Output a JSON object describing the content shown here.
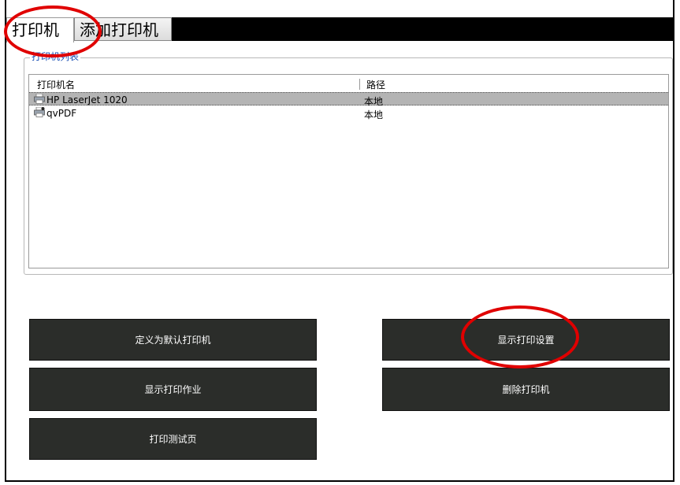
{
  "tabs": [
    {
      "label": "打印机"
    },
    {
      "label": "添加打印机"
    }
  ],
  "printer_group": {
    "title": "打印机列表",
    "columns": [
      "打印机名",
      "路径"
    ],
    "rows": [
      {
        "name": "HP LaserJet 1020",
        "path": "本地",
        "selected": true
      },
      {
        "name": "qvPDF",
        "path": "本地",
        "selected": false
      }
    ]
  },
  "buttons": {
    "set_default": "定义为默认打印机",
    "show_jobs": "显示打印作业",
    "print_test": "打印测试页",
    "show_settings": "显示打印设置",
    "delete_printer": "删除打印机"
  },
  "colors": {
    "button_bg": "#2b2d2a",
    "highlight_ring": "#e00000",
    "group_title": "#1a4fb4"
  },
  "icons": {
    "printer": "printer-icon",
    "pdf_printer": "pdf-printer-icon"
  }
}
